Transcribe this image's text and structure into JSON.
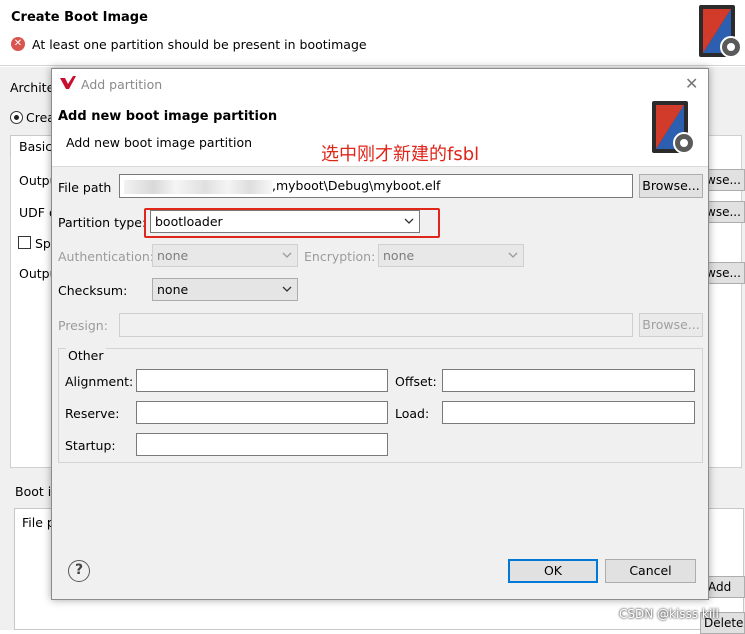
{
  "wizard": {
    "title": "Create Boot Image",
    "error_message": "At least one partition should be present in bootimage",
    "architecture_label": "Architec",
    "create_option": "Crea",
    "tab_basic": "Basic",
    "output_label_1": "Outpu",
    "udf_label": "UDF d",
    "split_label": "Spl",
    "output_label_2": "Outpu",
    "browse_partial": "wse...",
    "boot_image_label": "Boot i",
    "file_col_partial": "File p",
    "add_button": "Add",
    "delete_button": "Delete"
  },
  "dialog": {
    "window_title": "Add partition",
    "header_title": "Add new boot image partition",
    "header_subtitle": "Add new boot image partition",
    "annotation": "选中刚才新建的fsbl",
    "file_path_label": "File path",
    "file_path_value": ",myboot\\Debug\\myboot.elf",
    "browse_label": "Browse...",
    "partition_type_label": "Partition type:",
    "partition_type_value": "bootloader",
    "authentication_label": "Authentication:",
    "authentication_value": "none",
    "encryption_label": "Encryption:",
    "encryption_value": "none",
    "checksum_label": "Checksum:",
    "checksum_value": "none",
    "presign_label": "Presign:",
    "presign_browse_label": "Browse...",
    "other_group_label": "Other",
    "alignment_label": "Alignment:",
    "offset_label": "Offset:",
    "reserve_label": "Reserve:",
    "load_label": "Load:",
    "startup_label": "Startup:",
    "help_glyph": "?",
    "ok_label": "OK",
    "cancel_label": "Cancel"
  },
  "watermark": "CSDN @kisss kill",
  "colors": {
    "annotation_red": "#e0251b",
    "error_red": "#d9534f",
    "focus_blue": "#0078d7"
  }
}
